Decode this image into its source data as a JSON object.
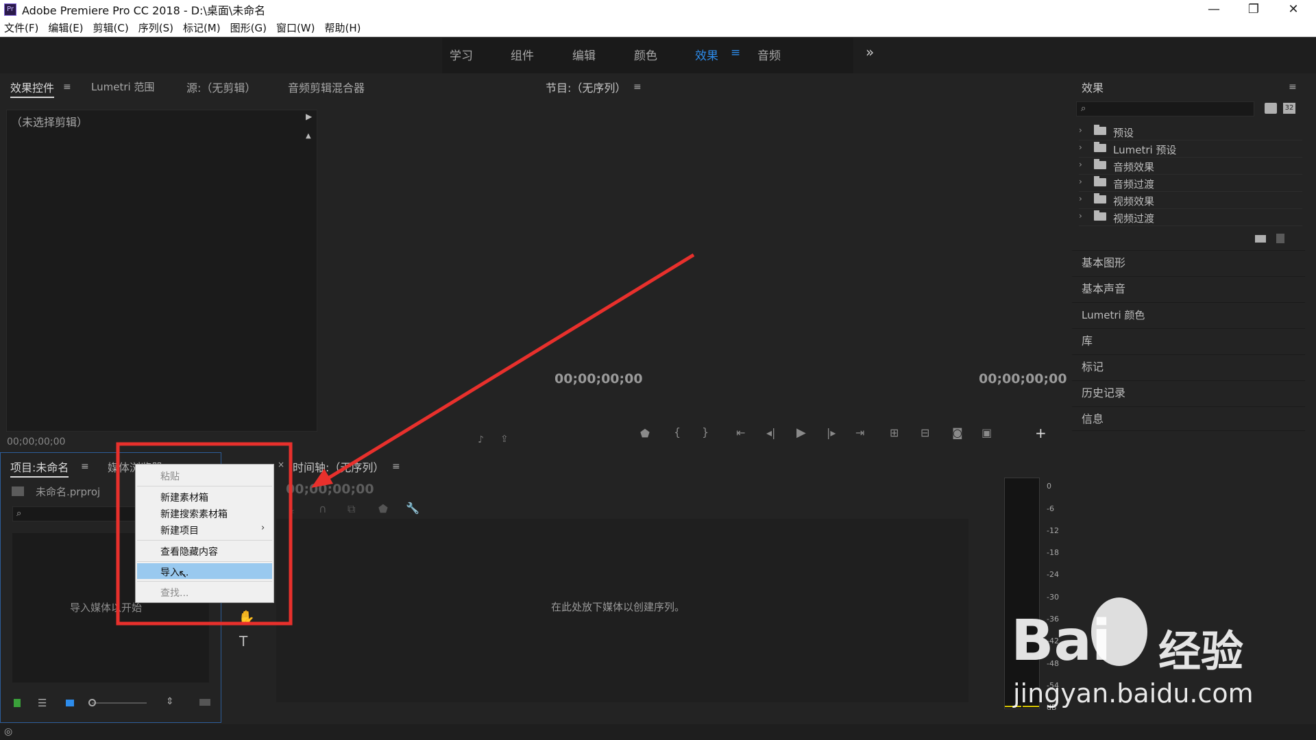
{
  "window": {
    "title": "Adobe Premiere Pro CC 2018 - D:\\桌面\\未命名",
    "logo": "Pr"
  },
  "menu": [
    "文件(F)",
    "编辑(E)",
    "剪辑(C)",
    "序列(S)",
    "标记(M)",
    "图形(G)",
    "窗口(W)",
    "帮助(H)"
  ],
  "workspaces": [
    "学习",
    "组件",
    "编辑",
    "颜色",
    "效果",
    "音频"
  ],
  "active_workspace": "效果",
  "accent_color": "#2d8ceb",
  "effect_controls": {
    "tabs": [
      "效果控件",
      "Lumetri 范围",
      "源:（无剪辑）",
      "音频剪辑混合器"
    ],
    "no_clip": "（未选择剪辑）",
    "timecode": "00;00;00;00"
  },
  "program": {
    "title": "节目:（无序列）",
    "tc_left": "00;00;00;00",
    "tc_right": "00;00;00;00"
  },
  "effects_panel": {
    "title": "效果",
    "search_placeholder": "",
    "items": [
      "预设",
      "Lumetri 预设",
      "音频效果",
      "音频过渡",
      "视频效果",
      "视频过渡"
    ],
    "sections": [
      "基本图形",
      "基本声音",
      "Lumetri 颜色",
      "库",
      "标记",
      "历史记录",
      "信息"
    ]
  },
  "project": {
    "tab": "项目:未命名",
    "tab2": "媒体浏览器",
    "file": "未命名.prproj",
    "hint": "导入媒体以开始"
  },
  "timeline": {
    "title": "时间轴:（无序列）",
    "timecode": "00;00;00;00",
    "hint": "在此处放下媒体以创建序列。"
  },
  "context_menu": {
    "items": [
      "粘贴",
      "新建素材箱",
      "新建搜索素材箱",
      "新建项目",
      "查看隐藏内容",
      "导入...",
      "查找..."
    ],
    "highlighted": "导入...",
    "highlight_color": "#99c9ef"
  },
  "meter_labels": [
    "0",
    "-6",
    "-12",
    "-18",
    "-24",
    "-30",
    "-36",
    "-42",
    "-48",
    "-54",
    "dB"
  ],
  "watermark": {
    "brand": "Bai",
    "brand2": "经验",
    "url": "jingyan.baidu.com"
  },
  "annotation_color": "#e8302c"
}
